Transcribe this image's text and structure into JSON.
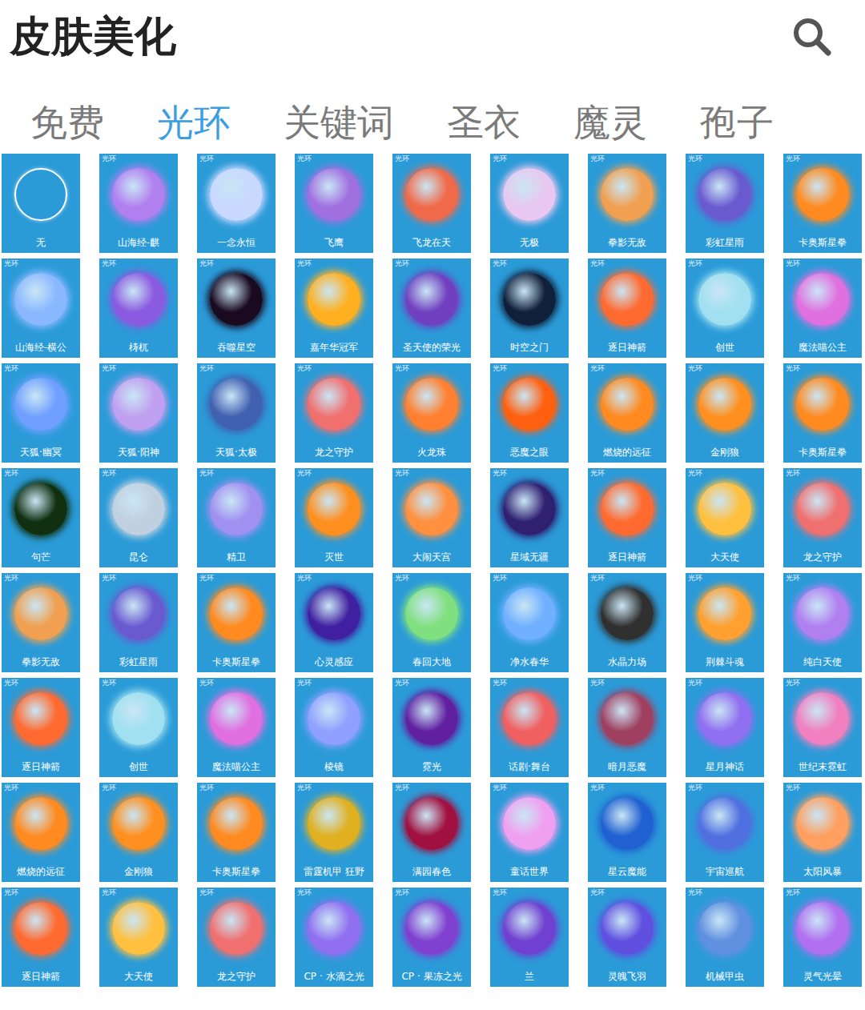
{
  "header": {
    "title": "皮肤美化"
  },
  "tabs": [
    {
      "label": "免费",
      "selected": false
    },
    {
      "label": "光环",
      "selected": true
    },
    {
      "label": "关键词",
      "selected": false
    },
    {
      "label": "圣衣",
      "selected": false
    },
    {
      "label": "魔灵",
      "selected": false
    },
    {
      "label": "孢子",
      "selected": false
    }
  ],
  "items": [
    {
      "label": "无",
      "kind": "ring",
      "color": "#ffffff"
    },
    {
      "label": "山海经-麒",
      "badge": "光环",
      "kind": "orb",
      "color": "#b07ff0"
    },
    {
      "label": "一念永恒",
      "badge": "光环",
      "kind": "orb",
      "color": "#c8d8ff"
    },
    {
      "label": "飞鹰",
      "badge": "光环",
      "kind": "orb",
      "color": "#a070e0"
    },
    {
      "label": "飞龙在天",
      "badge": "光环",
      "kind": "orb",
      "color": "#f06a4a"
    },
    {
      "label": "无极",
      "badge": "光环",
      "kind": "orb",
      "color": "#e8c8f0"
    },
    {
      "label": "拳影无敌",
      "badge": "光环",
      "kind": "orb",
      "color": "#f0a050"
    },
    {
      "label": "彩虹星雨",
      "badge": "光环",
      "kind": "orb",
      "color": "#6a5ad0"
    },
    {
      "label": "卡奥斯星拳",
      "badge": "光环",
      "kind": "orb",
      "color": "#ff8a20"
    },
    {
      "label": "山海经-横公",
      "badge": "光环",
      "kind": "orb",
      "color": "#8ab8ff"
    },
    {
      "label": "梼杌",
      "badge": "光环",
      "kind": "orb",
      "color": "#8a5ae0"
    },
    {
      "label": "吞噬星空",
      "badge": "光环",
      "kind": "orb",
      "color": "#1a0a20"
    },
    {
      "label": "嘉年华冠军",
      "badge": "光环",
      "kind": "orb",
      "color": "#ffb020"
    },
    {
      "label": "圣天使的荣光",
      "badge": "光环",
      "kind": "orb",
      "color": "#7040c0"
    },
    {
      "label": "时空之门",
      "badge": "光环",
      "kind": "orb",
      "color": "#10203a"
    },
    {
      "label": "逐日神箭",
      "badge": "光环",
      "kind": "orb",
      "color": "#ff6a30"
    },
    {
      "label": "创世",
      "badge": "光环",
      "kind": "orb",
      "color": "#a0e0f0"
    },
    {
      "label": "魔法喵公主",
      "badge": "光环",
      "kind": "orb",
      "color": "#e070e0"
    },
    {
      "label": "天狐·幽冥",
      "badge": "光环",
      "kind": "orb",
      "color": "#70a0ff"
    },
    {
      "label": "天狐·阳神",
      "badge": "光环",
      "kind": "orb",
      "color": "#c0a0f0"
    },
    {
      "label": "天狐·太极",
      "badge": "光环",
      "kind": "orb",
      "color": "#4060b0"
    },
    {
      "label": "龙之守护",
      "badge": "光环",
      "kind": "orb",
      "color": "#f07070"
    },
    {
      "label": "火龙珠",
      "badge": "光环",
      "kind": "orb",
      "color": "#ff8030"
    },
    {
      "label": "恶魔之眼",
      "badge": "光环",
      "kind": "orb",
      "color": "#ff6010"
    },
    {
      "label": "燃烧的远征",
      "badge": "光环",
      "kind": "orb",
      "color": "#ff8a20"
    },
    {
      "label": "金刚狼",
      "badge": "光环",
      "kind": "orb",
      "color": "#ff9020"
    },
    {
      "label": "卡奥斯星拳",
      "badge": "光环",
      "kind": "orb",
      "color": "#ff8a20"
    },
    {
      "label": "句芒",
      "badge": "光环",
      "kind": "orb",
      "color": "#103010"
    },
    {
      "label": "昆仑",
      "badge": "光环",
      "kind": "orb",
      "color": "#c0d0e0"
    },
    {
      "label": "精卫",
      "badge": "光环",
      "kind": "orb",
      "color": "#a090f0"
    },
    {
      "label": "灭世",
      "badge": "光环",
      "kind": "orb",
      "color": "#ff9020"
    },
    {
      "label": "大闹天宫",
      "badge": "光环",
      "kind": "orb",
      "color": "#ff9040"
    },
    {
      "label": "星域无疆",
      "badge": "光环",
      "kind": "orb",
      "color": "#302070"
    },
    {
      "label": "逐日神箭",
      "badge": "光环",
      "kind": "orb",
      "color": "#ff6a30"
    },
    {
      "label": "大天使",
      "badge": "光环",
      "kind": "orb",
      "color": "#ffc040"
    },
    {
      "label": "龙之守护",
      "badge": "光环",
      "kind": "orb",
      "color": "#f07070"
    },
    {
      "label": "拳影无敌",
      "badge": "光环",
      "kind": "orb",
      "color": "#f0a050"
    },
    {
      "label": "彩虹星雨",
      "badge": "光环",
      "kind": "orb",
      "color": "#6a5ad0"
    },
    {
      "label": "卡奥斯星拳",
      "badge": "光环",
      "kind": "orb",
      "color": "#ff8a20"
    },
    {
      "label": "心灵感应",
      "badge": "光环",
      "kind": "orb",
      "color": "#4020a0"
    },
    {
      "label": "春回大地",
      "badge": "光环",
      "kind": "orb",
      "color": "#80e080"
    },
    {
      "label": "净水春华",
      "badge": "光环",
      "kind": "orb",
      "color": "#70b0ff"
    },
    {
      "label": "水晶力场",
      "badge": "光环",
      "kind": "orb",
      "color": "#303030"
    },
    {
      "label": "荆棘斗魂",
      "badge": "光环",
      "kind": "orb",
      "color": "#ffa030"
    },
    {
      "label": "纯白天使",
      "badge": "光环",
      "kind": "orb",
      "color": "#b080f0"
    },
    {
      "label": "逐日神箭",
      "badge": "光环",
      "kind": "orb",
      "color": "#ff6a30"
    },
    {
      "label": "创世",
      "badge": "光环",
      "kind": "orb",
      "color": "#a0e0f0"
    },
    {
      "label": "魔法喵公主",
      "badge": "光环",
      "kind": "orb",
      "color": "#e070e0"
    },
    {
      "label": "棱镜",
      "badge": "光环",
      "kind": "orb",
      "color": "#90a0ff"
    },
    {
      "label": "霓光",
      "badge": "光环",
      "kind": "orb",
      "color": "#6020a0"
    },
    {
      "label": "话剧·舞台",
      "badge": "光环",
      "kind": "orb",
      "color": "#f06060"
    },
    {
      "label": "暗月恶魔",
      "badge": "光环",
      "kind": "orb",
      "color": "#a04060"
    },
    {
      "label": "星月神话",
      "badge": "光环",
      "kind": "orb",
      "color": "#9070f0"
    },
    {
      "label": "世纪末霓虹",
      "badge": "光环",
      "kind": "orb",
      "color": "#f080c0"
    },
    {
      "label": "燃烧的远征",
      "badge": "光环",
      "kind": "orb",
      "color": "#ff8a20"
    },
    {
      "label": "金刚狼",
      "badge": "光环",
      "kind": "orb",
      "color": "#ff9020"
    },
    {
      "label": "卡奥斯星拳",
      "badge": "光环",
      "kind": "orb",
      "color": "#ff8a20"
    },
    {
      "label": "雷霆机甲 狂野",
      "badge": "光环",
      "kind": "orb",
      "color": "#e0b020"
    },
    {
      "label": "满园春色",
      "badge": "光环",
      "kind": "orb",
      "color": "#a01040"
    },
    {
      "label": "童话世界",
      "badge": "光环",
      "kind": "orb",
      "color": "#f0a0f0"
    },
    {
      "label": "星云魔能",
      "badge": "光环",
      "kind": "orb",
      "color": "#2060d0"
    },
    {
      "label": "宇宙巡航",
      "badge": "光环",
      "kind": "orb",
      "color": "#5070e0"
    },
    {
      "label": "太阳风暴",
      "badge": "光环",
      "kind": "orb",
      "color": "#ffa060"
    },
    {
      "label": "逐日神箭",
      "badge": "光环",
      "kind": "orb",
      "color": "#ff6a30"
    },
    {
      "label": "大天使",
      "badge": "光环",
      "kind": "orb",
      "color": "#ffc040"
    },
    {
      "label": "龙之守护",
      "badge": "光环",
      "kind": "orb",
      "color": "#f07070"
    },
    {
      "label": "CP · 水滴之光",
      "badge": "光环",
      "kind": "orb",
      "color": "#9070f0"
    },
    {
      "label": "CP · 果冻之光",
      "badge": "光环",
      "kind": "orb",
      "color": "#8040d0"
    },
    {
      "label": "兰",
      "badge": "光环",
      "kind": "orb",
      "color": "#7040d0"
    },
    {
      "label": "灵魄飞羽",
      "badge": "光环",
      "kind": "orb",
      "color": "#6050e0"
    },
    {
      "label": "机械甲虫",
      "badge": "光环",
      "kind": "orb",
      "color": "#6090e0"
    },
    {
      "label": "灵气光晕",
      "badge": "光环",
      "kind": "orb",
      "color": "#b070f0"
    }
  ]
}
